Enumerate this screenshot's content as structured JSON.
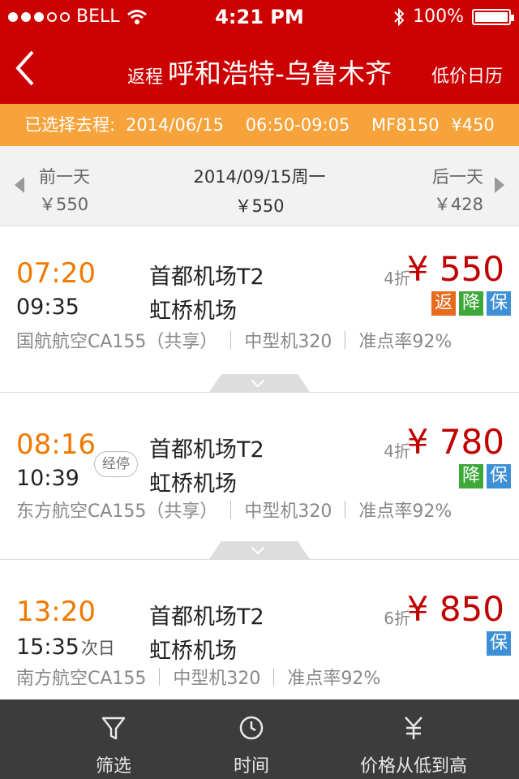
{
  "status": {
    "carrier": "BELL",
    "time": "4:21 PM",
    "battery": "100%"
  },
  "header": {
    "prefix": "返程",
    "route": "呼和浩特-乌鲁木齐",
    "calendar": "低价日历"
  },
  "selected": {
    "label": "已选择去程:",
    "date": "2014/06/15",
    "time": "06:50-09:05",
    "flight": "MF8150",
    "price": "¥450"
  },
  "datenav": {
    "prev": {
      "label": "前一天",
      "price": "￥550"
    },
    "current": {
      "date": "2014/09/15周一",
      "price": "￥550"
    },
    "next": {
      "label": "后一天",
      "price": "￥428"
    }
  },
  "flights": [
    {
      "dep": "07:20",
      "arr": "09:35",
      "next_day": "",
      "from": "首都机场T2",
      "to": "虹桥机场",
      "discount": "4折",
      "price": "¥ 550",
      "badges": [
        "返",
        "降",
        "保"
      ],
      "airline": "国航航空CA155（共享）",
      "plane": "中型机320",
      "ontime": "准点率92%",
      "stop": ""
    },
    {
      "dep": "08:16",
      "arr": "10:39",
      "next_day": "",
      "from": "首都机场T2",
      "to": "虹桥机场",
      "discount": "4折",
      "price": "¥ 780",
      "badges": [
        "降",
        "保"
      ],
      "airline": "东方航空CA155（共享）",
      "plane": "中型机320",
      "ontime": "准点率92%",
      "stop": "经停"
    },
    {
      "dep": "13:20",
      "arr": "15:35",
      "next_day": "次日",
      "from": "首都机场T2",
      "to": "虹桥机场",
      "discount": "6折",
      "price": "¥ 850",
      "badges": [
        "保"
      ],
      "airline": "南方航空CA155",
      "plane": "中型机320",
      "ontime": "准点率92%",
      "stop": ""
    }
  ],
  "bottom": [
    {
      "label": "筛选",
      "icon": "filter-icon"
    },
    {
      "label": "时间",
      "icon": "clock-icon"
    },
    {
      "label": "价格从低到高",
      "icon": "yuan-icon"
    }
  ],
  "colors": {
    "header": "#cc0000",
    "orange": "#f6a33b",
    "dep_time": "#f07800",
    "price": "#c00000"
  }
}
